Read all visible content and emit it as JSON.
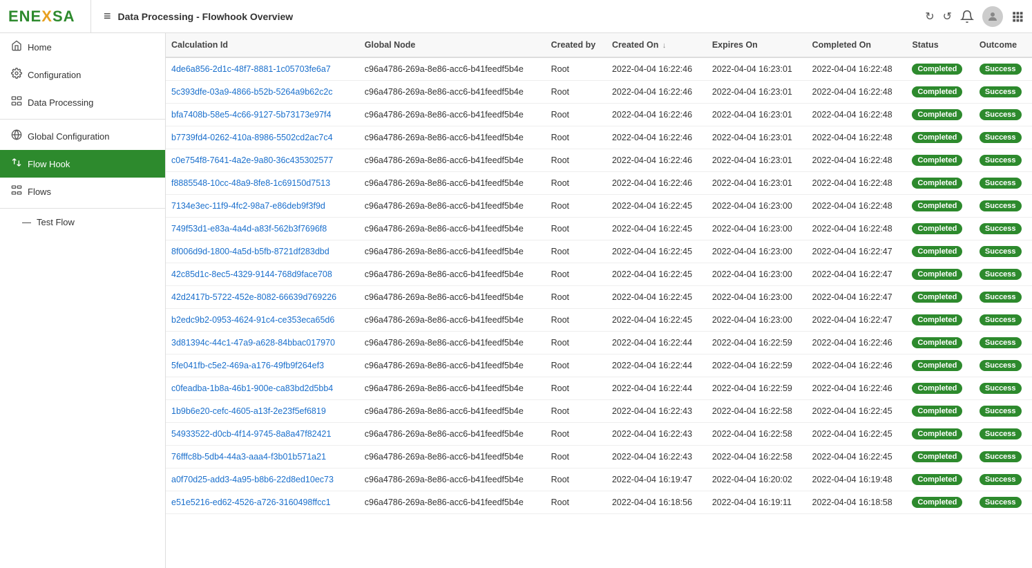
{
  "logo": {
    "text_start": "ENE",
    "text_x": "X",
    "text_end": "SA"
  },
  "topbar": {
    "menu_icon": "≡",
    "title": "Data Processing - Flowhook Overview",
    "refresh_icon_1": "↻",
    "refresh_icon_2": "↺",
    "bell_icon": "🔔",
    "grid_icon": "⊞"
  },
  "sidebar": {
    "items": [
      {
        "id": "home",
        "label": "Home",
        "icon": "⌂",
        "active": false
      },
      {
        "id": "configuration",
        "label": "Configuration",
        "icon": "⚙",
        "active": false
      },
      {
        "id": "data-processing",
        "label": "Data Processing",
        "icon": "⋮⋮",
        "active": false
      },
      {
        "id": "global-configuration",
        "label": "Global Configuration",
        "icon": "🌐",
        "active": false
      },
      {
        "id": "flow-hook",
        "label": "Flow Hook",
        "icon": "⇌",
        "active": true
      },
      {
        "id": "flows",
        "label": "Flows",
        "icon": "⋮⋮",
        "active": false
      },
      {
        "id": "test-flow",
        "label": "Test Flow",
        "icon": "—",
        "active": false
      }
    ]
  },
  "table": {
    "columns": [
      {
        "id": "calc-id",
        "label": "Calculation Id"
      },
      {
        "id": "global-node",
        "label": "Global Node"
      },
      {
        "id": "created-by",
        "label": "Created by"
      },
      {
        "id": "created-on",
        "label": "Created On",
        "sort": "↓"
      },
      {
        "id": "expires-on",
        "label": "Expires On"
      },
      {
        "id": "completed-on",
        "label": "Completed On"
      },
      {
        "id": "status",
        "label": "Status"
      },
      {
        "id": "outcome",
        "label": "Outcome"
      }
    ],
    "rows": [
      {
        "calc_id": "4de6a856-2d1c-48f7-8881-1c05703fe6a7",
        "global_node": "c96a4786-269a-8e86-acc6-b41feedf5b4e",
        "created_by": "Root",
        "created_on": "2022-04-04 16:22:46",
        "expires_on": "2022-04-04 16:23:01",
        "completed_on": "2022-04-04 16:22:48",
        "status": "Completed",
        "outcome": "Success"
      },
      {
        "calc_id": "5c393dfe-03a9-4866-b52b-5264a9b62c2c",
        "global_node": "c96a4786-269a-8e86-acc6-b41feedf5b4e",
        "created_by": "Root",
        "created_on": "2022-04-04 16:22:46",
        "expires_on": "2022-04-04 16:23:01",
        "completed_on": "2022-04-04 16:22:48",
        "status": "Completed",
        "outcome": "Success"
      },
      {
        "calc_id": "bfa7408b-58e5-4c66-9127-5b73173e97f4",
        "global_node": "c96a4786-269a-8e86-acc6-b41feedf5b4e",
        "created_by": "Root",
        "created_on": "2022-04-04 16:22:46",
        "expires_on": "2022-04-04 16:23:01",
        "completed_on": "2022-04-04 16:22:48",
        "status": "Completed",
        "outcome": "Success"
      },
      {
        "calc_id": "b7739fd4-0262-410a-8986-5502cd2ac7c4",
        "global_node": "c96a4786-269a-8e86-acc6-b41feedf5b4e",
        "created_by": "Root",
        "created_on": "2022-04-04 16:22:46",
        "expires_on": "2022-04-04 16:23:01",
        "completed_on": "2022-04-04 16:22:48",
        "status": "Completed",
        "outcome": "Success"
      },
      {
        "calc_id": "c0e754f8-7641-4a2e-9a80-36c435302577",
        "global_node": "c96a4786-269a-8e86-acc6-b41feedf5b4e",
        "created_by": "Root",
        "created_on": "2022-04-04 16:22:46",
        "expires_on": "2022-04-04 16:23:01",
        "completed_on": "2022-04-04 16:22:48",
        "status": "Completed",
        "outcome": "Success"
      },
      {
        "calc_id": "f8885548-10cc-48a9-8fe8-1c69150d7513",
        "global_node": "c96a4786-269a-8e86-acc6-b41feedf5b4e",
        "created_by": "Root",
        "created_on": "2022-04-04 16:22:46",
        "expires_on": "2022-04-04 16:23:01",
        "completed_on": "2022-04-04 16:22:48",
        "status": "Completed",
        "outcome": "Success"
      },
      {
        "calc_id": "7134e3ec-11f9-4fc2-98a7-e86deb9f3f9d",
        "global_node": "c96a4786-269a-8e86-acc6-b41feedf5b4e",
        "created_by": "Root",
        "created_on": "2022-04-04 16:22:45",
        "expires_on": "2022-04-04 16:23:00",
        "completed_on": "2022-04-04 16:22:48",
        "status": "Completed",
        "outcome": "Success"
      },
      {
        "calc_id": "749f53d1-e83a-4a4d-a83f-562b3f7696f8",
        "global_node": "c96a4786-269a-8e86-acc6-b41feedf5b4e",
        "created_by": "Root",
        "created_on": "2022-04-04 16:22:45",
        "expires_on": "2022-04-04 16:23:00",
        "completed_on": "2022-04-04 16:22:48",
        "status": "Completed",
        "outcome": "Success"
      },
      {
        "calc_id": "8f006d9d-1800-4a5d-b5fb-8721df283dbd",
        "global_node": "c96a4786-269a-8e86-acc6-b41feedf5b4e",
        "created_by": "Root",
        "created_on": "2022-04-04 16:22:45",
        "expires_on": "2022-04-04 16:23:00",
        "completed_on": "2022-04-04 16:22:47",
        "status": "Completed",
        "outcome": "Success"
      },
      {
        "calc_id": "42c85d1c-8ec5-4329-9144-768d9face708",
        "global_node": "c96a4786-269a-8e86-acc6-b41feedf5b4e",
        "created_by": "Root",
        "created_on": "2022-04-04 16:22:45",
        "expires_on": "2022-04-04 16:23:00",
        "completed_on": "2022-04-04 16:22:47",
        "status": "Completed",
        "outcome": "Success"
      },
      {
        "calc_id": "42d2417b-5722-452e-8082-66639d769226",
        "global_node": "c96a4786-269a-8e86-acc6-b41feedf5b4e",
        "created_by": "Root",
        "created_on": "2022-04-04 16:22:45",
        "expires_on": "2022-04-04 16:23:00",
        "completed_on": "2022-04-04 16:22:47",
        "status": "Completed",
        "outcome": "Success"
      },
      {
        "calc_id": "b2edc9b2-0953-4624-91c4-ce353eca65d6",
        "global_node": "c96a4786-269a-8e86-acc6-b41feedf5b4e",
        "created_by": "Root",
        "created_on": "2022-04-04 16:22:45",
        "expires_on": "2022-04-04 16:23:00",
        "completed_on": "2022-04-04 16:22:47",
        "status": "Completed",
        "outcome": "Success"
      },
      {
        "calc_id": "3d81394c-44c1-47a9-a628-84bbac017970",
        "global_node": "c96a4786-269a-8e86-acc6-b41feedf5b4e",
        "created_by": "Root",
        "created_on": "2022-04-04 16:22:44",
        "expires_on": "2022-04-04 16:22:59",
        "completed_on": "2022-04-04 16:22:46",
        "status": "Completed",
        "outcome": "Success"
      },
      {
        "calc_id": "5fe041fb-c5e2-469a-a176-49fb9f264ef3",
        "global_node": "c96a4786-269a-8e86-acc6-b41feedf5b4e",
        "created_by": "Root",
        "created_on": "2022-04-04 16:22:44",
        "expires_on": "2022-04-04 16:22:59",
        "completed_on": "2022-04-04 16:22:46",
        "status": "Completed",
        "outcome": "Success"
      },
      {
        "calc_id": "c0feadba-1b8a-46b1-900e-ca83bd2d5bb4",
        "global_node": "c96a4786-269a-8e86-acc6-b41feedf5b4e",
        "created_by": "Root",
        "created_on": "2022-04-04 16:22:44",
        "expires_on": "2022-04-04 16:22:59",
        "completed_on": "2022-04-04 16:22:46",
        "status": "Completed",
        "outcome": "Success"
      },
      {
        "calc_id": "1b9b6e20-cefc-4605-a13f-2e23f5ef6819",
        "global_node": "c96a4786-269a-8e86-acc6-b41feedf5b4e",
        "created_by": "Root",
        "created_on": "2022-04-04 16:22:43",
        "expires_on": "2022-04-04 16:22:58",
        "completed_on": "2022-04-04 16:22:45",
        "status": "Completed",
        "outcome": "Success"
      },
      {
        "calc_id": "54933522-d0cb-4f14-9745-8a8a47f82421",
        "global_node": "c96a4786-269a-8e86-acc6-b41feedf5b4e",
        "created_by": "Root",
        "created_on": "2022-04-04 16:22:43",
        "expires_on": "2022-04-04 16:22:58",
        "completed_on": "2022-04-04 16:22:45",
        "status": "Completed",
        "outcome": "Success"
      },
      {
        "calc_id": "76fffc8b-5db4-44a3-aaa4-f3b01b571a21",
        "global_node": "c96a4786-269a-8e86-acc6-b41feedf5b4e",
        "created_by": "Root",
        "created_on": "2022-04-04 16:22:43",
        "expires_on": "2022-04-04 16:22:58",
        "completed_on": "2022-04-04 16:22:45",
        "status": "Completed",
        "outcome": "Success"
      },
      {
        "calc_id": "a0f70d25-add3-4a95-b8b6-22d8ed10ec73",
        "global_node": "c96a4786-269a-8e86-acc6-b41feedf5b4e",
        "created_by": "Root",
        "created_on": "2022-04-04 16:19:47",
        "expires_on": "2022-04-04 16:20:02",
        "completed_on": "2022-04-04 16:19:48",
        "status": "Completed",
        "outcome": "Success"
      },
      {
        "calc_id": "e51e5216-ed62-4526-a726-3160498ffcc1",
        "global_node": "c96a4786-269a-8e86-acc6-b41feedf5b4e",
        "created_by": "Root",
        "created_on": "2022-04-04 16:18:56",
        "expires_on": "2022-04-04 16:19:11",
        "completed_on": "2022-04-04 16:18:58",
        "status": "Completed",
        "outcome": "Success"
      }
    ]
  }
}
